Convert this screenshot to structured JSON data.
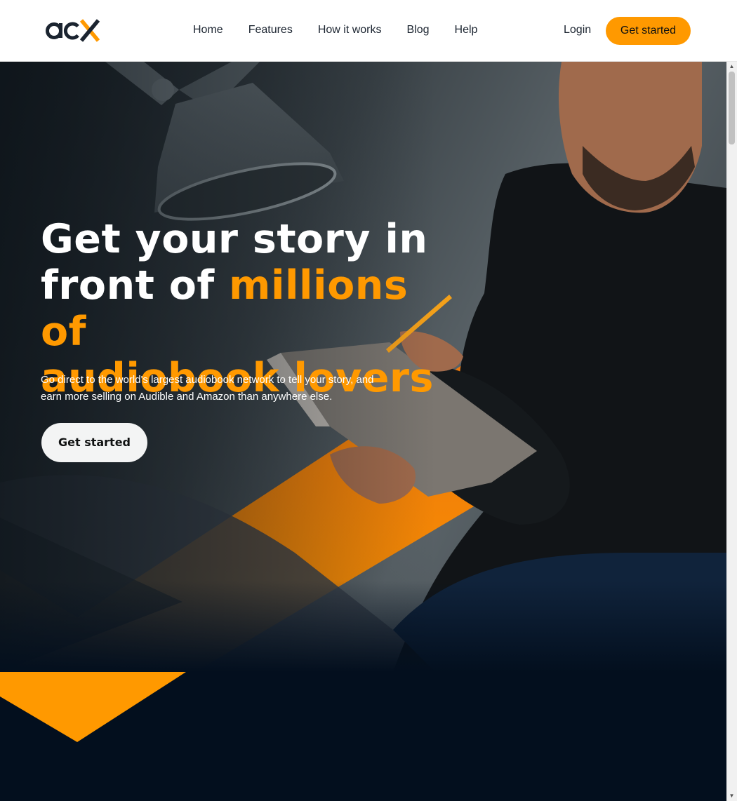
{
  "brand": {
    "logo_alt": "acx",
    "accent_color": "#ff9900",
    "dark_color": "#030f1e"
  },
  "nav": {
    "items": [
      {
        "label": "Home"
      },
      {
        "label": "Features"
      },
      {
        "label": "How it works"
      },
      {
        "label": "Blog"
      },
      {
        "label": "Help"
      }
    ],
    "login_label": "Login",
    "cta_label": "Get started"
  },
  "hero": {
    "headline_white_1": "Get your story in",
    "headline_white_2": "front of ",
    "headline_accent_1": "millions of",
    "headline_accent_2": "audiobook lovers",
    "subtext": "Go direct to the world's largest audiobook network to tell your story, and earn more selling on Audible and Amazon than anywhere else.",
    "cta_label": "Get started",
    "image_icon": "man-reading-notebook-photo"
  },
  "scrollbar": {
    "up_icon": "arrow-up-icon",
    "down_icon": "arrow-down-icon"
  }
}
